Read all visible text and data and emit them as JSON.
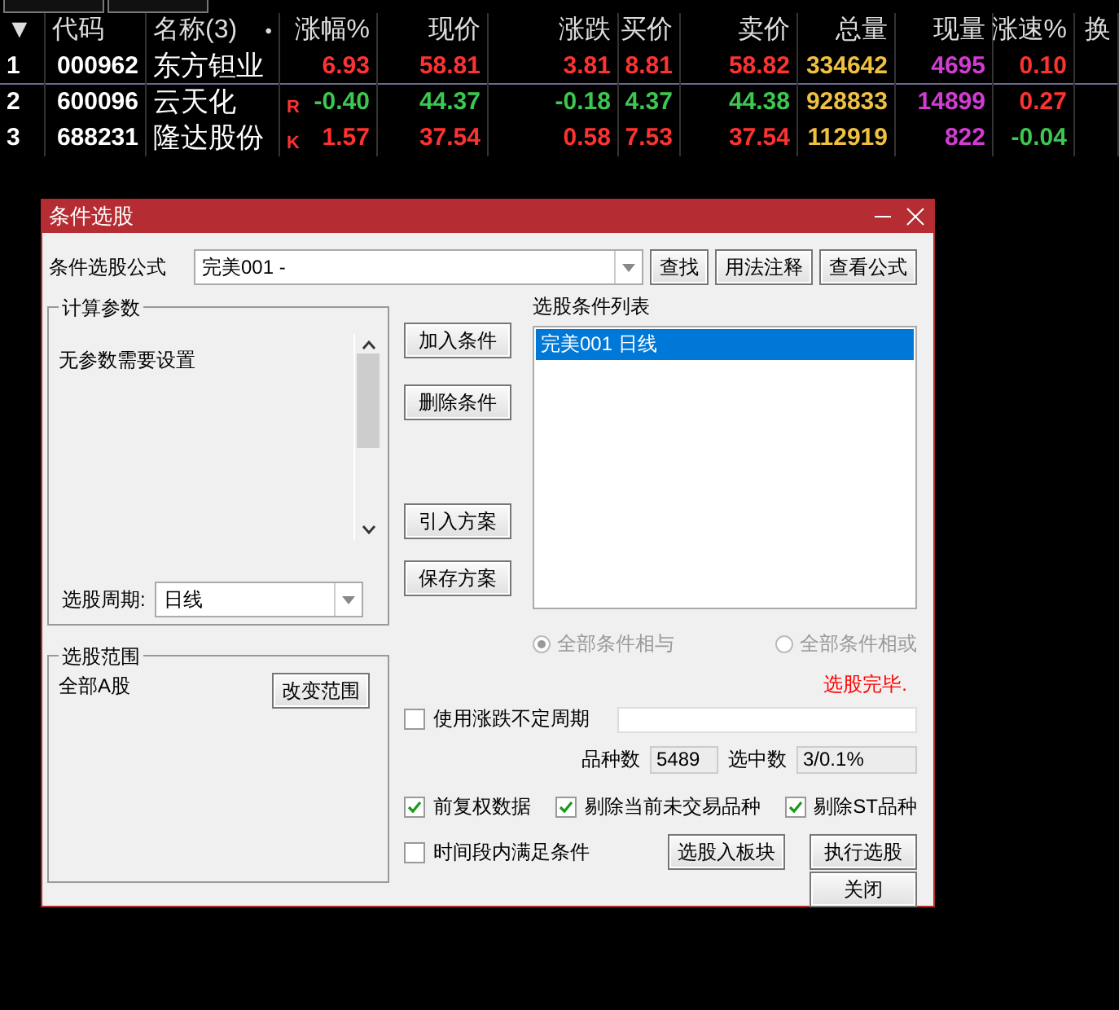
{
  "table": {
    "columns": [
      {
        "label": "▼"
      },
      {
        "label": "代码"
      },
      {
        "label": "名称(3)",
        "marker": "•"
      },
      {
        "label": "涨幅%"
      },
      {
        "label": "现价"
      },
      {
        "label": "涨跌"
      },
      {
        "label": "买价"
      },
      {
        "label": "卖价"
      },
      {
        "label": "总量"
      },
      {
        "label": "现量"
      },
      {
        "label": "涨速%"
      },
      {
        "label": "换"
      }
    ],
    "rows": [
      {
        "selected": true,
        "cells": [
          {
            "text": "1"
          },
          {
            "text": "000962"
          },
          {
            "text": "东方钽业"
          },
          {
            "text": "6.93",
            "color": "#ff3232"
          },
          {
            "text": "58.81",
            "color": "#ff3232"
          },
          {
            "text": "3.81",
            "color": "#ff3232"
          },
          {
            "text": "8.81",
            "color": "#ff3232"
          },
          {
            "text": "58.82",
            "color": "#ff3232"
          },
          {
            "text": "334642",
            "color": "#f0c040"
          },
          {
            "text": "4695",
            "color": "#d23cd2"
          },
          {
            "text": "0.10",
            "color": "#ff3232"
          }
        ]
      },
      {
        "selected": false,
        "cells": [
          {
            "text": "2"
          },
          {
            "text": "600096"
          },
          {
            "text": "云天化"
          },
          {
            "text": "-0.40",
            "color": "#3cc850",
            "flag": "R"
          },
          {
            "text": "44.37",
            "color": "#3cc850"
          },
          {
            "text": "-0.18",
            "color": "#3cc850"
          },
          {
            "text": "4.37",
            "color": "#3cc850"
          },
          {
            "text": "44.38",
            "color": "#3cc850"
          },
          {
            "text": "928833",
            "color": "#f0c040"
          },
          {
            "text": "14899",
            "color": "#d23cd2"
          },
          {
            "text": "0.27",
            "color": "#ff3232"
          }
        ]
      },
      {
        "selected": false,
        "cells": [
          {
            "text": "3"
          },
          {
            "text": "688231"
          },
          {
            "text": "隆达股份"
          },
          {
            "text": "1.57",
            "color": "#ff3232",
            "flag": "K"
          },
          {
            "text": "37.54",
            "color": "#ff3232"
          },
          {
            "text": "0.58",
            "color": "#ff3232"
          },
          {
            "text": "7.53",
            "color": "#ff3232"
          },
          {
            "text": "37.54",
            "color": "#ff3232"
          },
          {
            "text": "112919",
            "color": "#f0c040"
          },
          {
            "text": "822",
            "color": "#d23cd2"
          },
          {
            "text": "-0.04",
            "color": "#3cc850"
          }
        ]
      }
    ]
  },
  "dialog": {
    "title": "条件选股",
    "formula": {
      "label": "条件选股公式",
      "value": "完美001  -"
    },
    "top_buttons": [
      "查找",
      "用法注释",
      "查看公式"
    ],
    "params": {
      "title": "计算参数",
      "text": "无参数需要设置"
    },
    "period": {
      "label": "选股周期:",
      "value": "日线"
    },
    "scope": {
      "title": "选股范围",
      "value": "全部A股",
      "button": "改变范围"
    },
    "actions": [
      "加入条件",
      "删除条件",
      "引入方案",
      "保存方案"
    ],
    "condition_list": {
      "title": "选股条件列表",
      "items": [
        {
          "text": "完美001  日线",
          "selected": true
        }
      ]
    },
    "logic": [
      {
        "label": "全部条件相与",
        "selected": true,
        "disabled": true
      },
      {
        "label": "全部条件相或",
        "selected": false,
        "disabled": true
      }
    ],
    "status": "选股完毕.",
    "variable_period": {
      "label": "使用涨跌不定周期",
      "checked": false
    },
    "counts": [
      {
        "label": "品种数",
        "value": "5489"
      },
      {
        "label": "选中数",
        "value": "3/0.1%"
      }
    ],
    "options": [
      {
        "label": "前复权数据",
        "checked": true
      },
      {
        "label": "剔除当前未交易品种",
        "checked": true
      },
      {
        "label": "剔除ST品种",
        "checked": true
      }
    ],
    "time_condition": {
      "label": "时间段内满足条件",
      "checked": false
    },
    "bottom_buttons": [
      "选股入板块",
      "执行选股",
      "关闭"
    ]
  }
}
